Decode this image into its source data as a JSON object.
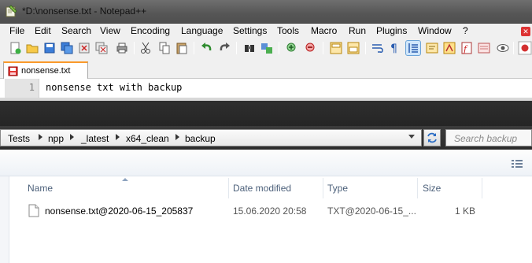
{
  "notepad": {
    "title": "*D:\\nonsense.txt - Notepad++",
    "menu": [
      "File",
      "Edit",
      "Search",
      "View",
      "Encoding",
      "Language",
      "Settings",
      "Tools",
      "Macro",
      "Run",
      "Plugins",
      "Window",
      "?"
    ],
    "tab_label": "nonsense.txt",
    "line_number": "1",
    "line_text": "nonsense txt with backup"
  },
  "explorer": {
    "breadcrumb": [
      "Tests",
      "npp",
      "_latest",
      "x64_clean",
      "backup"
    ],
    "search_placeholder": "Search backup",
    "columns": {
      "name": "Name",
      "date": "Date modified",
      "type": "Type",
      "size": "Size"
    },
    "rows": [
      {
        "name": "nonsense.txt@2020-06-15_205837",
        "date": "15.06.2020 20:58",
        "type": "TXT@2020-06-15_...",
        "size": "1 KB"
      }
    ]
  },
  "colors": {
    "tab_accent": "#fa9a2b",
    "header_text": "#4c607a",
    "row_text": "#444444"
  }
}
